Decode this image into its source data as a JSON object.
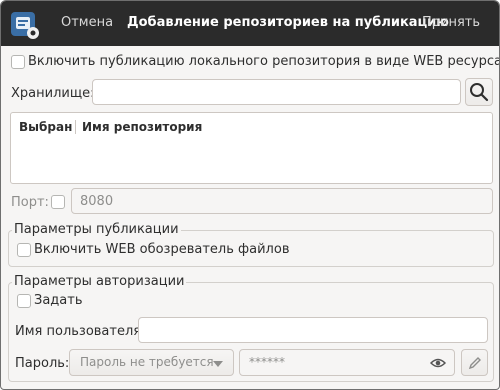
{
  "header": {
    "cancel_label": "Отмена",
    "title": "Добавление репозиториев на публикацию",
    "accept_label": "Принять"
  },
  "publish_web": {
    "checkbox_label": "Включить публикацию локального репозитория в виде WEB ресурса",
    "checked": false
  },
  "storage": {
    "label": "Хранилище:",
    "value": ""
  },
  "table": {
    "columns": [
      "Выбран",
      "Имя репозитория"
    ],
    "rows": []
  },
  "port": {
    "label": "Порт:",
    "checked": false,
    "value": "8080"
  },
  "publish_params": {
    "title": "Параметры публикации",
    "browser_label": "Включить WEB обозреватель файлов",
    "checked": false
  },
  "auth_params": {
    "title": "Параметры авторизации",
    "set_label": "Задать",
    "set_checked": false,
    "username_label": "Имя пользователя:",
    "username_value": "",
    "password_label": "Пароль:",
    "password_mode": "Пароль не требуется",
    "password_value": "******"
  },
  "colors": {
    "header_bg": "#2b2b2b",
    "window_bg": "#f6f5f4",
    "border": "#cdc7c2"
  },
  "icons": [
    "app-icon",
    "search-icon",
    "eye-icon",
    "pencil-icon",
    "chevron-down-icon"
  ]
}
